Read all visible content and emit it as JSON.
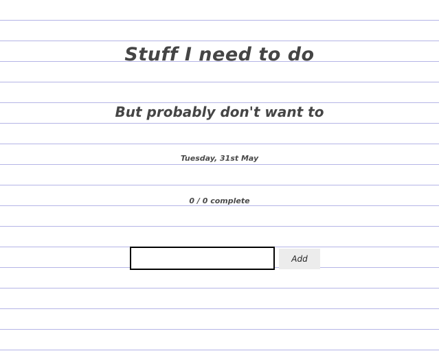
{
  "header": {
    "title": "Stuff I need to do",
    "subtitle": "But probably don't want to"
  },
  "date": "Tuesday, 31st May",
  "progress": {
    "text": "0 / 0 complete",
    "completed": 0,
    "total": 0
  },
  "form": {
    "input_value": "",
    "input_placeholder": "",
    "add_label": "Add"
  },
  "colors": {
    "ruled_line": "#b4b4e6",
    "text": "#444444",
    "input_border": "#000000",
    "button_bg": "#ececec"
  }
}
